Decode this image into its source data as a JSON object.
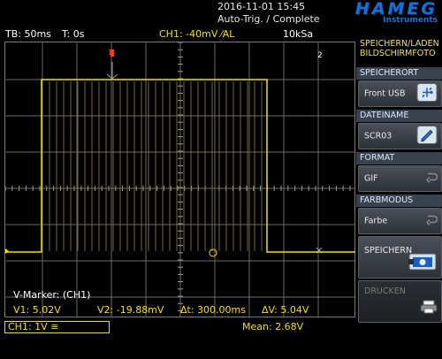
{
  "header": {
    "date": "2016-11-01 15:45",
    "trigger_state": "Auto-Trig. / Complete",
    "brand": "HAMEG",
    "brand_sub": "Instruments"
  },
  "status": {
    "timebase": "TB: 50ms",
    "trigger_time": "T: 0s",
    "channel": "CH1: -40mV ⁄AL",
    "sample_rate": "10kSa"
  },
  "grid": {
    "marker_1": "1",
    "marker_2": "2"
  },
  "menu": {
    "title_line1": "SPEICHERN/LADEN",
    "title_line2": "BILDSCHIRMFOTO",
    "sections": {
      "speicherort": "SPEICHERORT",
      "dateiname": "DATEINAME",
      "format": "FORMAT",
      "farbmodus": "FARBMODUS"
    },
    "buttons": {
      "front_usb": "Front USB",
      "scr03": "SCR03",
      "gif": "GIF",
      "farbe": "Farbe",
      "speichern": "SPEICHERN",
      "drucken": "DRUCKEN"
    }
  },
  "markers": {
    "title": "V-Marker: (CH1)",
    "v1": "V1: 5.02V",
    "v2": "V2: -19.88mV",
    "dt": "Δt: 300.00ms",
    "dv": "ΔV: 5.04V"
  },
  "bottom": {
    "ch1_scale": "CH1: 1V ≅",
    "mean": "Mean: 2.68V"
  },
  "colors": {
    "trace": "#f4e000",
    "grid": "#7a7a7a",
    "brand": "#1a6fd4",
    "cursor": "#f04020"
  },
  "icons": {
    "usb": "usb-icon",
    "edit": "edit-icon",
    "return": "return-arrow-icon",
    "camera": "camera-save-icon",
    "printer": "printer-icon"
  }
}
